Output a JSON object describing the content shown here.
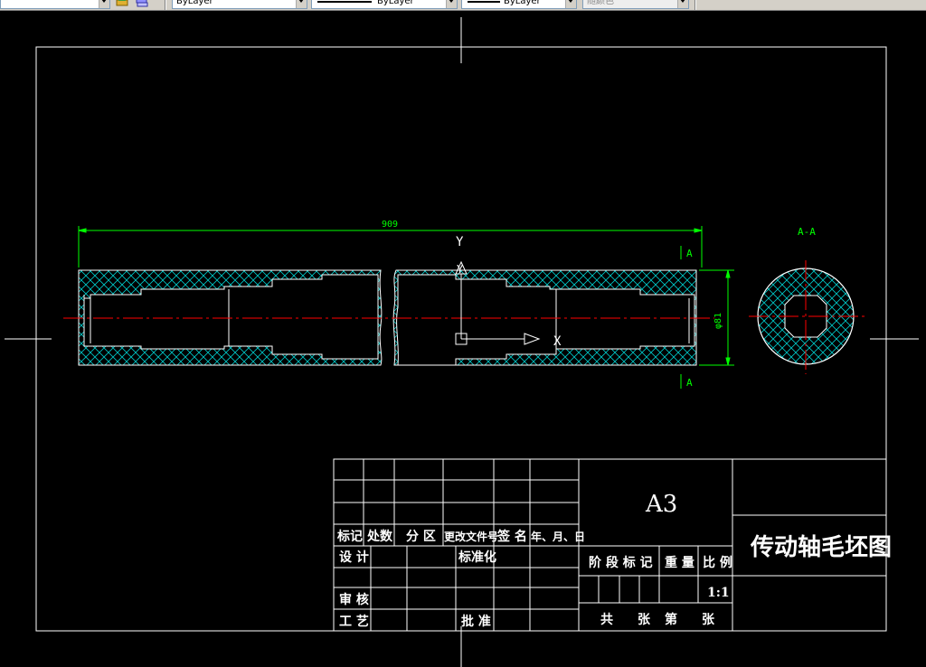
{
  "toolbar": {
    "layer_color_value": "ByLayer",
    "linetype_value": "ByLayer",
    "lineweight_value": "ByLayer",
    "plotstyle_value": "随颜色"
  },
  "drawing": {
    "overall_length": "909",
    "diameter": "φ81",
    "section_label_top": "A",
    "section_label_bottom": "A",
    "section_view_title": "A-A",
    "ucs_y": "Y",
    "ucs_x": "X",
    "ucs_cross_y": "Y"
  },
  "title_block": {
    "sheet_size": "A3",
    "drawing_name": "传动轴毛坯图",
    "revision_headers": [
      "标记",
      "处数",
      "分 区",
      "更改文件号",
      "签 名",
      "年、月、日"
    ],
    "design_label": "设 计",
    "standardize_label": "标准化",
    "review_label": "审 核",
    "process_label": "工 艺",
    "approve_label": "批 准",
    "stage_label": "阶 段 标 记",
    "weight_label": "重 量",
    "scale_label": "比 例",
    "scale_value": "1:1",
    "total_label": "共",
    "sheet_label": "张",
    "page_label": "第",
    "sheet_label_2": "张"
  },
  "colors": {
    "background": "#000000",
    "outline": "#ffffff",
    "dimension": "#00ff00",
    "centerline": "#ff0000",
    "hatch": "#00c8c8"
  }
}
